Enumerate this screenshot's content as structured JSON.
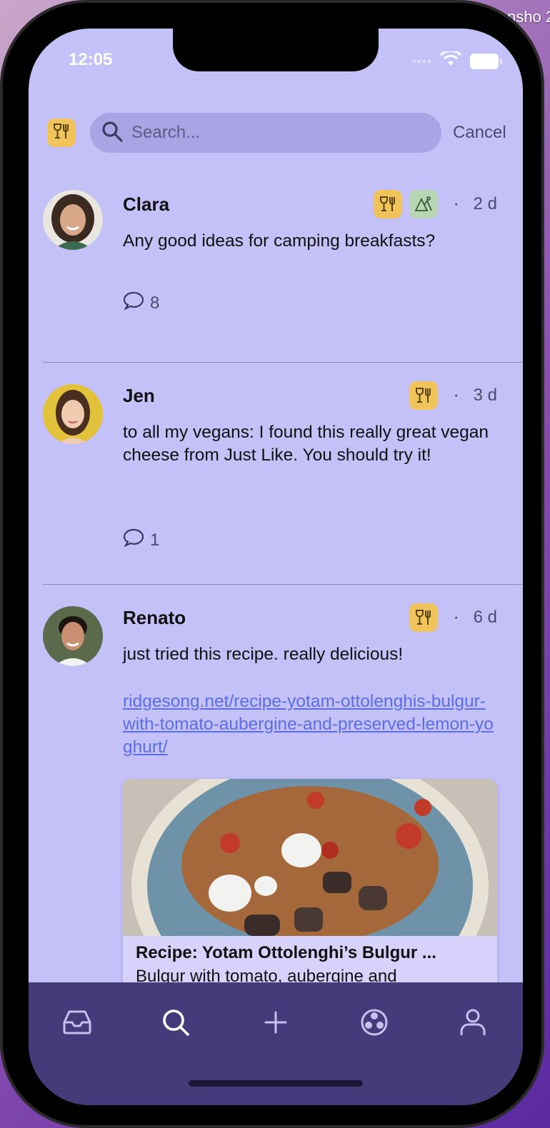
{
  "desktop_label": "nsho\n2.",
  "status_bar": {
    "time": "12:05"
  },
  "search": {
    "filter_badge": "food-drink-icon",
    "placeholder": "Search...",
    "cancel_label": "Cancel"
  },
  "posts": [
    {
      "author": "Clara",
      "badges": [
        "food-drink-icon",
        "outdoors-icon"
      ],
      "age": "2 d",
      "text": "Any good ideas for camping breakfasts?",
      "comment_count": "8"
    },
    {
      "author": "Jen",
      "badges": [
        "food-drink-icon"
      ],
      "age": "3 d",
      "text": "to all my vegans: I found this really great vegan cheese from Just Like. You should try it!",
      "comment_count": "1"
    },
    {
      "author": "Renato",
      "badges": [
        "food-drink-icon"
      ],
      "age": "6 d",
      "text": "just tried this recipe. really delicious!",
      "link": "ridgesong.net/recipe-yotam-ottolenghis-bulgur-with-tomato-aubergine-and-preserved-lemon-yoghurt/",
      "card_title": "Recipe: Yotam Ottolenghi’s Bulgur ...",
      "card_desc": "Bulgur with tomato, aubergine and"
    }
  ],
  "tabbar": [
    "inbox-icon",
    "search-icon",
    "plus-icon",
    "groups-icon",
    "profile-icon"
  ],
  "colors": {
    "screen_bg": "#c4c0f8",
    "tabbar_bg": "#453a7a",
    "badge_food": "#f0c45a",
    "badge_outdoor": "#b9d6b4",
    "link": "#5b6ee6"
  }
}
